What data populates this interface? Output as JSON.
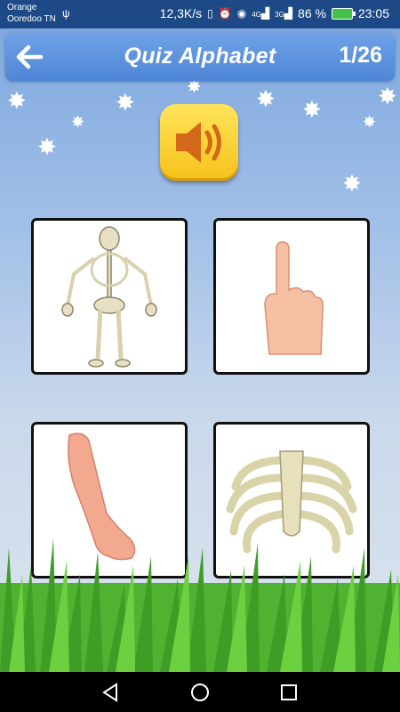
{
  "status_bar": {
    "carrier_line1": "Orange",
    "carrier_line2": "Ooredoo TN",
    "speed": "12,3K/s",
    "battery": "86 %",
    "time": "23:05",
    "net1": "4G",
    "net2": "3G"
  },
  "header": {
    "title": "Quiz Alphabet",
    "progress": "1/26"
  },
  "icons": {
    "back": "arrow-left-icon",
    "sound": "speaker-icon",
    "nav_back": "triangle-back-icon",
    "nav_home": "circle-home-icon",
    "nav_recents": "square-recents-icon"
  },
  "options": [
    {
      "image": "skeleton"
    },
    {
      "image": "finger"
    },
    {
      "image": "arm"
    },
    {
      "image": "ribcage"
    }
  ],
  "colors": {
    "statusbar": "#1d4a86",
    "topbar": "#5b92de",
    "sound_button": "#f8c92a"
  }
}
